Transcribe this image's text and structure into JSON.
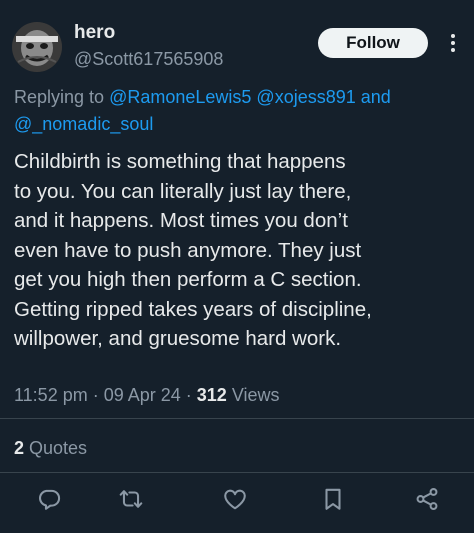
{
  "author": {
    "display_name": "hero",
    "handle": "@Scott617565908"
  },
  "follow_label": "Follow",
  "reply_context": {
    "prefix": "Replying to ",
    "mention_1": "@RamoneLewis5",
    "mention_2": "@xojess891",
    "conjunction": " and ",
    "mention_3": "@_nomadic_soul"
  },
  "tweet_text": "Childbirth is something that happens\nto you. You can literally just lay there,\nand it happens. Most times you don’t\neven have to push anymore. They just\nget you high then perform a C section.\nGetting ripped takes years of discipline,\nwillpower, and gruesome hard work.",
  "meta": {
    "time": "11:52 pm",
    "date": "09 Apr 24",
    "separator": " · ",
    "views_count": "312",
    "views_label": " Views"
  },
  "quotes": {
    "count": "2",
    "label": " Quotes"
  },
  "actions": [
    "reply-icon",
    "retweet-icon",
    "like-icon",
    "bookmark-icon",
    "share-icon"
  ],
  "colors": {
    "background": "#15202b",
    "text": "#e7e9ea",
    "secondary": "#8b98a5",
    "link": "#1d9bf0",
    "divider": "#38444d",
    "follow_bg": "#eff3f4"
  }
}
